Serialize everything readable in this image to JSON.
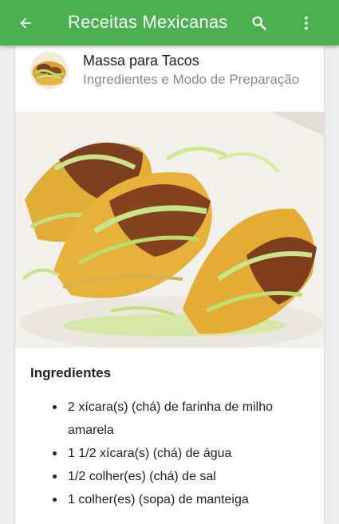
{
  "app_bar": {
    "title": "Receitas Mexicanas",
    "color": "#4caf50",
    "back_icon": "arrow-back-icon",
    "search_icon": "search-icon",
    "menu_icon": "more-vert-icon"
  },
  "recipe": {
    "title": "Massa para Tacos",
    "subtitle": "Ingredientes e Modo de Preparação"
  },
  "ingredients": {
    "heading": "Ingredientes",
    "items": [
      "2 xícara(s) (chá) de farinha de milho amarela",
      "1 1/2 xícara(s) (chá) de água",
      "1/2 colher(es) (chá) de sal",
      "1 colher(es) (sopa) de manteiga"
    ]
  }
}
